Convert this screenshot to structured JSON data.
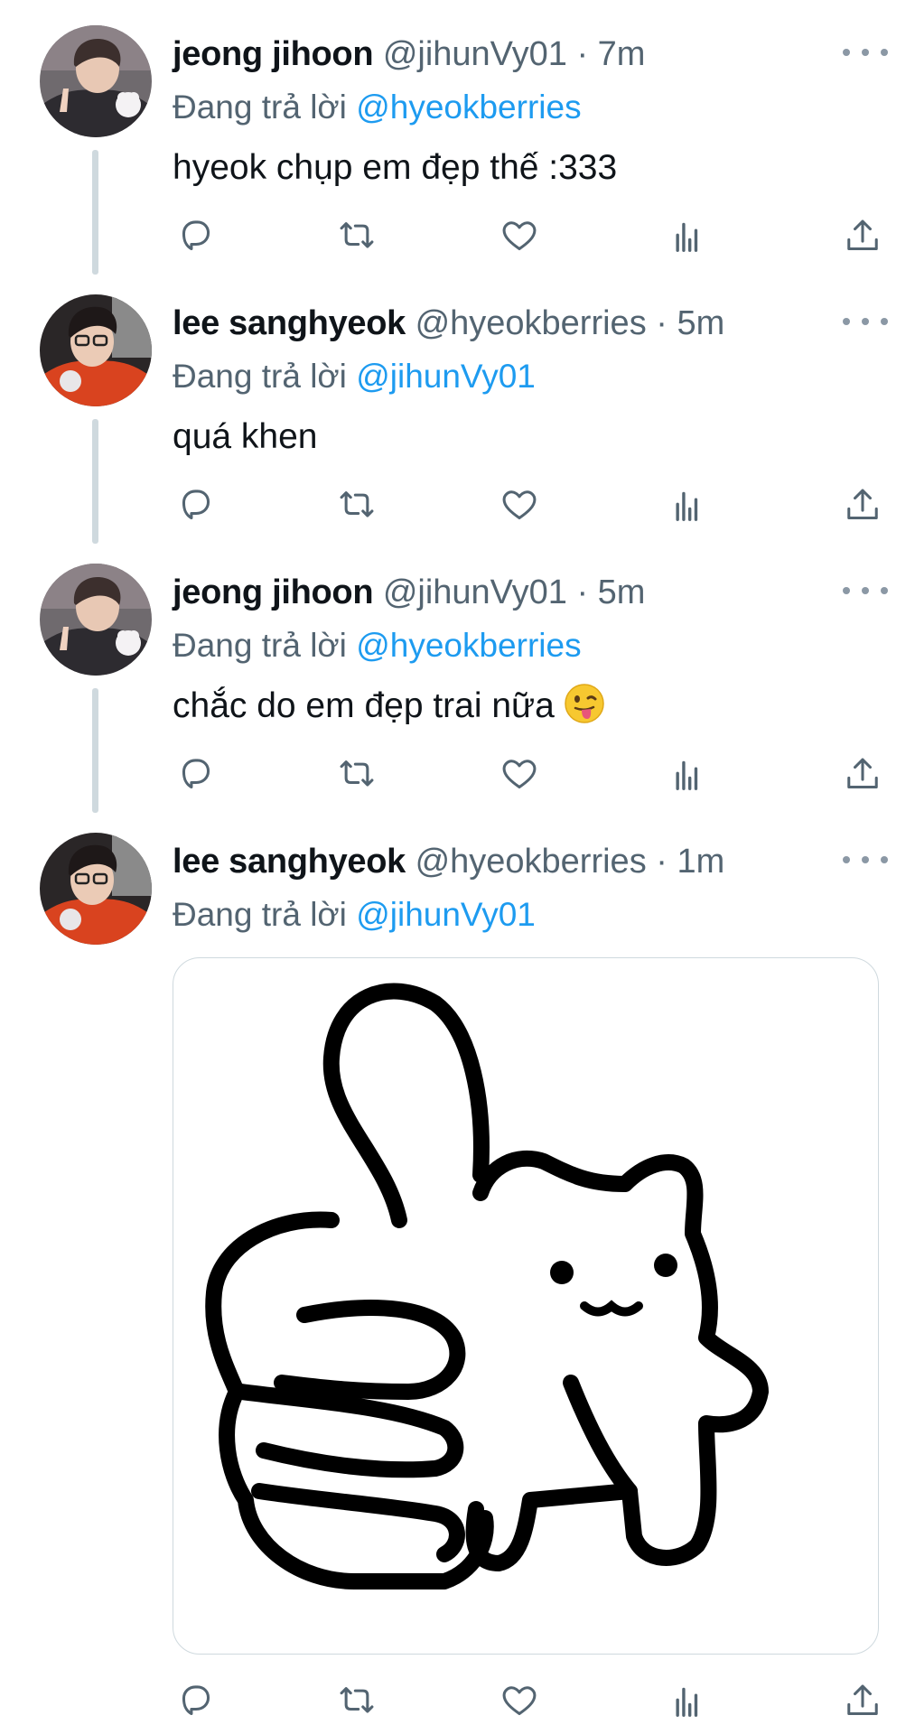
{
  "tweets": [
    {
      "name": "jeong jihoon",
      "handle": "@jihunVy01",
      "dot": "·",
      "time": "7m",
      "reply_prefix": "Đang trả lời",
      "reply_mention": "@hyeokberries",
      "text": "hyeok chụp em đẹp thế :333"
    },
    {
      "name": "lee sanghyeok",
      "handle": "@hyeokberries",
      "dot": "·",
      "time": "5m",
      "reply_prefix": "Đang trả lời",
      "reply_mention": "@jihunVy01",
      "text": "quá khen"
    },
    {
      "name": "jeong jihoon",
      "handle": "@jihunVy01",
      "dot": "·",
      "time": "5m",
      "reply_prefix": "Đang trả lời",
      "reply_mention": "@hyeokberries",
      "text": "chắc do em đẹp trai nữa",
      "emoji": "😛"
    },
    {
      "name": "lee sanghyeok",
      "handle": "@hyeokberries",
      "dot": "·",
      "time": "1m",
      "reply_prefix": "Đang trả lời",
      "reply_mention": "@jihunVy01"
    }
  ],
  "colors": {
    "accent": "#1d9bf0",
    "text_primary": "#0f1419",
    "text_secondary": "#536471",
    "thread_line": "#cfd9de"
  },
  "icons": {
    "more": "more-dots-icon",
    "reply": "reply-bubble-icon",
    "retweet": "retweet-icon",
    "like": "heart-icon",
    "views": "views-bars-icon",
    "share": "share-upload-icon"
  }
}
